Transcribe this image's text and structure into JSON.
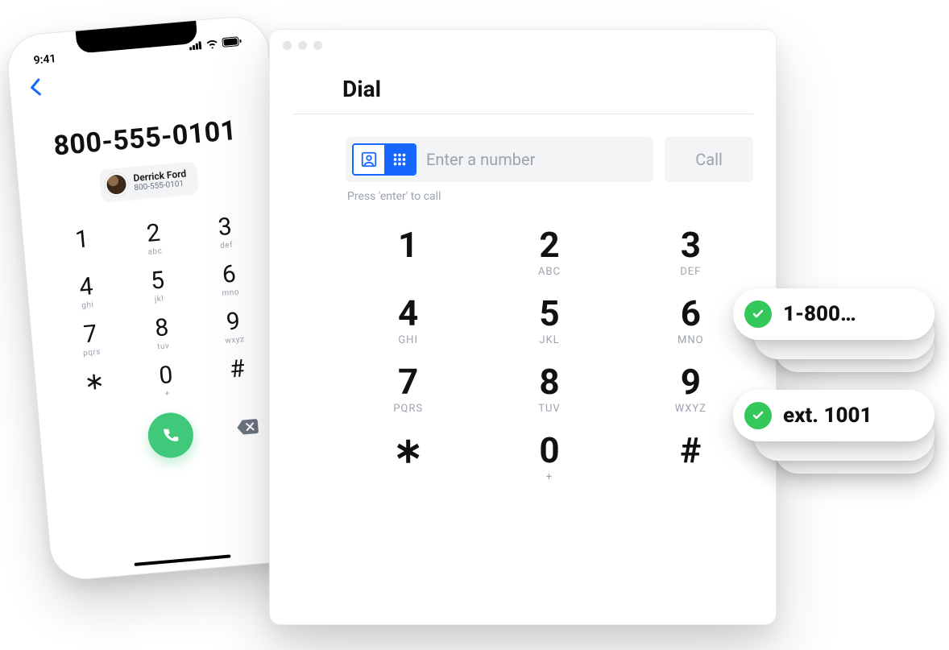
{
  "phone": {
    "time": "9:41",
    "number": "800-555-0101",
    "contact": {
      "name": "Derrick Ford",
      "sub": "800-555-0101"
    },
    "keys": [
      {
        "d": "1",
        "l": ""
      },
      {
        "d": "2",
        "l": "abc"
      },
      {
        "d": "3",
        "l": "def"
      },
      {
        "d": "4",
        "l": "ghi"
      },
      {
        "d": "5",
        "l": "jkl"
      },
      {
        "d": "6",
        "l": "mno"
      },
      {
        "d": "7",
        "l": "pqrs"
      },
      {
        "d": "8",
        "l": "tuv"
      },
      {
        "d": "9",
        "l": "wxyz"
      },
      {
        "d": "∗",
        "l": ""
      },
      {
        "d": "0",
        "l": "+"
      },
      {
        "d": "#",
        "l": ""
      }
    ]
  },
  "window": {
    "title": "Dial",
    "placeholder": "Enter a number",
    "hint": "Press 'enter' to call",
    "callLabel": "Call",
    "keys": [
      {
        "d": "1",
        "l": ""
      },
      {
        "d": "2",
        "l": "ABC"
      },
      {
        "d": "3",
        "l": "DEF"
      },
      {
        "d": "4",
        "l": "GHI"
      },
      {
        "d": "5",
        "l": "JKL"
      },
      {
        "d": "6",
        "l": "MNO"
      },
      {
        "d": "7",
        "l": "PQRS"
      },
      {
        "d": "8",
        "l": "TUV"
      },
      {
        "d": "9",
        "l": "WXYZ"
      },
      {
        "d": "∗",
        "l": ""
      },
      {
        "d": "0",
        "l": "+"
      },
      {
        "d": "#",
        "l": ""
      }
    ]
  },
  "chips": {
    "first": "1-800…",
    "second": "ext. 1001"
  }
}
